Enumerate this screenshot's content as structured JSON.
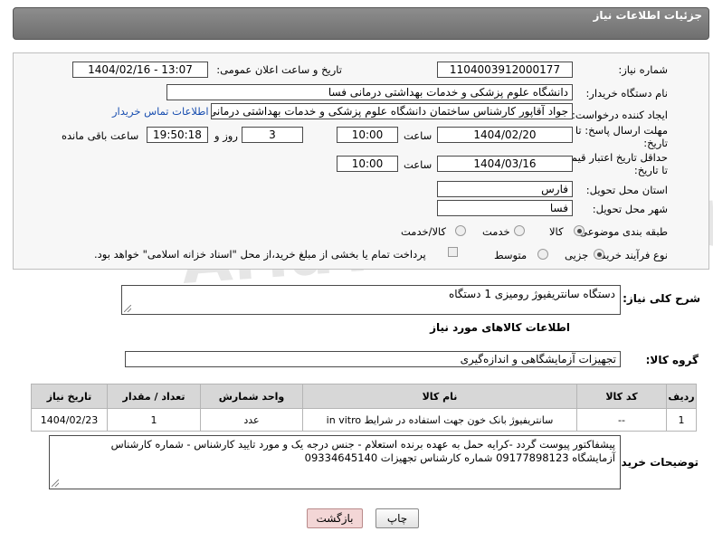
{
  "header": {
    "title": "جزئیات اطلاعات نیاز"
  },
  "form": {
    "need_number_label": "شماره نیاز:",
    "need_number": "1104003912000177",
    "announce_label": "تاریخ و ساعت اعلان عمومی:",
    "announce_value": "1404/02/16 - 13:07",
    "buyer_org_label": "نام دستگاه خریدار:",
    "buyer_org": "دانشگاه علوم پزشکی و خدمات بهداشتی درمانی فسا",
    "requester_label": "ایجاد کننده درخواست:",
    "requester": "جواد آقاپور کارشناس ساختمان دانشگاه علوم پزشکی و خدمات بهداشتی درمانی فسا",
    "contact_link": "اطلاعات تماس خریدار",
    "deadline_label": "مهلت ارسال پاسخ: تا تاریخ:",
    "deadline_date": "1404/02/20",
    "time_label": "ساعت",
    "deadline_time": "10:00",
    "days_count": "3",
    "days_label": "روز و",
    "remaining_time": "19:50:18",
    "remaining_label": "ساعت باقی مانده",
    "validity_label": "حداقل تاریخ اعتبار قیمت: تا تاریخ:",
    "validity_date": "1404/03/16",
    "validity_time": "10:00",
    "province_label": "استان محل تحویل:",
    "province": "فارس",
    "city_label": "شهر محل تحویل:",
    "city": "فسا",
    "category_label": "طبقه بندی موضوعی:",
    "category_options": [
      "کالا",
      "خدمت",
      "کالا/خدمت"
    ],
    "category_selected": "کالا",
    "process_label": "نوع فرآیند خرید :",
    "process_options": [
      "جزیی",
      "متوسط"
    ],
    "process_selected": "جزیی",
    "payment_note": "پرداخت تمام یا بخشی از مبلغ خرید،از محل \"اسناد خزانه اسلامی\" خواهد بود."
  },
  "description": {
    "label": "شرح کلی نیاز:",
    "value": "دستگاه سانتریفیوژ رومیزی      1 دستگاه"
  },
  "goods_section": {
    "title": "اطلاعات کالاهای مورد نیاز",
    "group_label": "گروه کالا:",
    "group_value": "تجهیزات آزمایشگاهی و اندازه‌گیری"
  },
  "table": {
    "headers": [
      "ردیف",
      "کد کالا",
      "نام کالا",
      "واحد شمارش",
      "تعداد / مقدار",
      "تاریخ نیاز"
    ],
    "rows": [
      [
        "1",
        "--",
        "سانتریفیوژ بانک خون جهت استفاده در شرایط in vitro",
        "عدد",
        "1",
        "1404/02/23"
      ]
    ]
  },
  "buyer_notes": {
    "label": "توضیحات خریدار:",
    "line1": "پیشفاکتور پیوست گردد -کرایه حمل به عهده برنده استعلام - جنس درجه یک و مورد تایید کارشناس - شماره کارشناس",
    "line2": "آزمایشگاه 09177898123   شماره کارشناس تجهیزات 09334645140"
  },
  "buttons": {
    "print": "چاپ",
    "back": "بازگشت"
  },
  "watermark": "AriaTender.net"
}
